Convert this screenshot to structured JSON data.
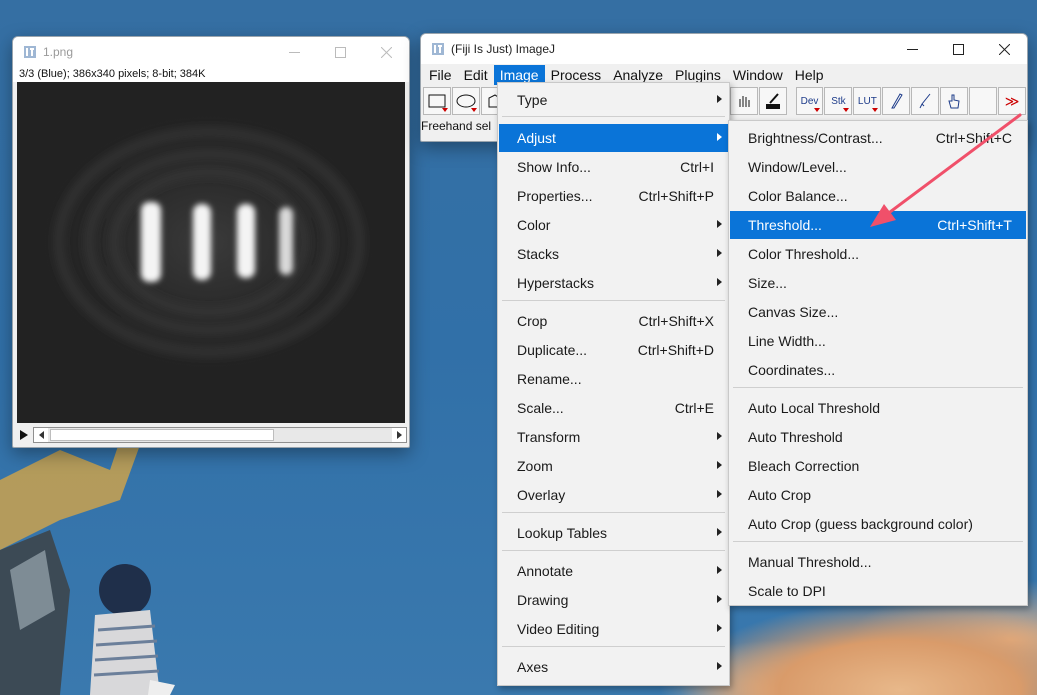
{
  "image_window": {
    "title": "1.png",
    "info": "3/3 (Blue); 386x340 pixels; 8-bit; 384K"
  },
  "imagej_window": {
    "title": "(Fiji Is Just) ImageJ",
    "menubar": [
      "File",
      "Edit",
      "Image",
      "Process",
      "Analyze",
      "Plugins",
      "Window",
      "Help"
    ],
    "active_menu": "Image",
    "toolbar": {
      "dev_label": "Dev",
      "stk_label": "Stk",
      "lut_label": "LUT",
      "more_label": "≫"
    },
    "status": "Freehand sel"
  },
  "image_menu": {
    "items": [
      {
        "label": "Type",
        "shortcut": "",
        "submenu": true
      },
      {
        "label": "Adjust",
        "shortcut": "",
        "submenu": true,
        "highlighted": true
      },
      {
        "label": "Show Info...",
        "shortcut": "Ctrl+I"
      },
      {
        "label": "Properties...",
        "shortcut": "Ctrl+Shift+P"
      },
      {
        "label": "Color",
        "shortcut": "",
        "submenu": true
      },
      {
        "label": "Stacks",
        "shortcut": "",
        "submenu": true
      },
      {
        "label": "Hyperstacks",
        "shortcut": "",
        "submenu": true
      },
      {
        "label": "Crop",
        "shortcut": "Ctrl+Shift+X"
      },
      {
        "label": "Duplicate...",
        "shortcut": "Ctrl+Shift+D"
      },
      {
        "label": "Rename...",
        "shortcut": ""
      },
      {
        "label": "Scale...",
        "shortcut": "Ctrl+E"
      },
      {
        "label": "Transform",
        "shortcut": "",
        "submenu": true
      },
      {
        "label": "Zoom",
        "shortcut": "",
        "submenu": true
      },
      {
        "label": "Overlay",
        "shortcut": "",
        "submenu": true
      },
      {
        "label": "Lookup Tables",
        "shortcut": "",
        "submenu": true
      },
      {
        "label": "Annotate",
        "shortcut": "",
        "submenu": true
      },
      {
        "label": "Drawing",
        "shortcut": "",
        "submenu": true
      },
      {
        "label": "Video Editing",
        "shortcut": "",
        "submenu": true
      },
      {
        "label": "Axes",
        "shortcut": "",
        "submenu": true
      }
    ]
  },
  "adjust_menu": {
    "items": [
      {
        "label": "Brightness/Contrast...",
        "shortcut": "Ctrl+Shift+C"
      },
      {
        "label": "Window/Level...",
        "shortcut": ""
      },
      {
        "label": "Color Balance...",
        "shortcut": ""
      },
      {
        "label": "Threshold...",
        "shortcut": "Ctrl+Shift+T",
        "highlighted": true
      },
      {
        "label": "Color Threshold...",
        "shortcut": ""
      },
      {
        "label": "Size...",
        "shortcut": ""
      },
      {
        "label": "Canvas Size...",
        "shortcut": ""
      },
      {
        "label": "Line Width...",
        "shortcut": ""
      },
      {
        "label": "Coordinates...",
        "shortcut": ""
      },
      {
        "label": "Auto Local Threshold",
        "shortcut": ""
      },
      {
        "label": "Auto Threshold",
        "shortcut": ""
      },
      {
        "label": "Bleach Correction",
        "shortcut": ""
      },
      {
        "label": "Auto Crop",
        "shortcut": ""
      },
      {
        "label": "Auto Crop (guess background color)",
        "shortcut": ""
      },
      {
        "label": "Manual Threshold...",
        "shortcut": ""
      },
      {
        "label": "Scale to DPI",
        "shortcut": ""
      }
    ]
  },
  "colors": {
    "highlight": "#0a74d8",
    "annotation_arrow": "#f0506a",
    "desktop": "#2f6a9e"
  }
}
